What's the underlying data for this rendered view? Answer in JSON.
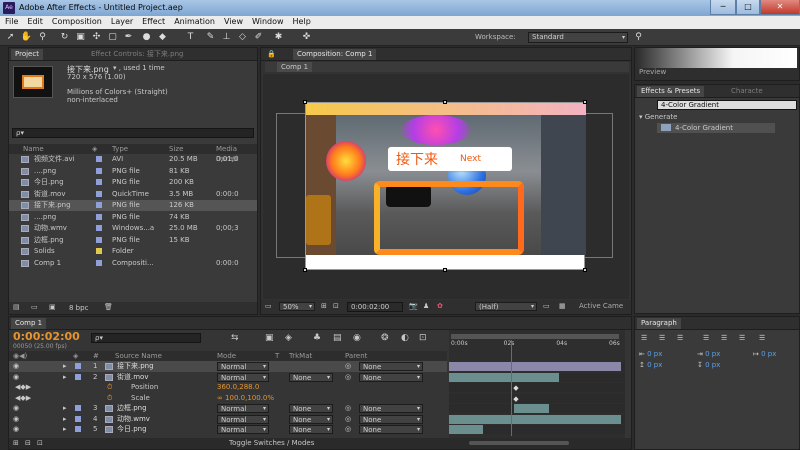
{
  "window": {
    "title": "Adobe After Effects - Untitled Project.aep",
    "app_badge": "Ae"
  },
  "menu": [
    "File",
    "Edit",
    "Composition",
    "Layer",
    "Effect",
    "Animation",
    "View",
    "Window",
    "Help"
  ],
  "toolbar": {
    "workspace_label": "Workspace:",
    "workspace_value": "Standard"
  },
  "project": {
    "tab_project": "Project",
    "tab_effect_controls": "Effect Controls: 接下来.png",
    "selected_name": "接下来.png",
    "selected_used": "▾ , used 1 time",
    "selected_dims": "720 x 576 (1.00)",
    "selected_colors": "Millions of Colors+ (Straight)",
    "selected_interlace": "non-interlaced",
    "search_placeholder": "ρ▾",
    "columns": [
      "Name",
      "Type",
      "Size",
      "Media Durati"
    ],
    "items": [
      {
        "name": "视频文件.avi",
        "type": "AVI",
        "size": "20.5 MB",
        "dur": "0;01;0",
        "color": "#8f9fd9"
      },
      {
        "name": "....png",
        "type": "PNG file",
        "size": "81 KB",
        "dur": "",
        "color": "#8f9fd9"
      },
      {
        "name": "今日.png",
        "type": "PNG file",
        "size": "200 KB",
        "dur": "",
        "color": "#8f9fd9"
      },
      {
        "name": "街道.mov",
        "type": "QuickTime",
        "size": "3.5 MB",
        "dur": "0:00:0",
        "color": "#8f9fd9"
      },
      {
        "name": "接下来.png",
        "type": "PNG file",
        "size": "126 KB",
        "dur": "",
        "color": "#8f9fd9"
      },
      {
        "name": "....png",
        "type": "PNG file",
        "size": "74 KB",
        "dur": "",
        "color": "#8f9fd9"
      },
      {
        "name": "动物.wmv",
        "type": "Windows...a",
        "size": "25.0 MB",
        "dur": "0;00;3",
        "color": "#8f9fd9"
      },
      {
        "name": "边框.png",
        "type": "PNG file",
        "size": "15 KB",
        "dur": "",
        "color": "#8f9fd9"
      },
      {
        "name": "Solids",
        "type": "Folder",
        "size": "",
        "dur": "",
        "color": "#e0c94a"
      },
      {
        "name": "Comp 1",
        "type": "Compositi...",
        "size": "",
        "dur": "0:00:0",
        "color": "#8f9fd9"
      }
    ],
    "bpc": "8 bpc"
  },
  "composition": {
    "tab": "Composition: Comp 1",
    "subtab": "Comp 1",
    "overlay_cn": "接下来",
    "overlay_en": "Next",
    "zoom": "50%",
    "time": "0:00:02:00",
    "resolution": "(Half)",
    "camera": "Active Came"
  },
  "preview": {
    "tab": "Preview"
  },
  "effects_presets": {
    "tab": "Effects & Presets",
    "tab2": "Characte",
    "search_value": "4-Color Gradient",
    "category": "Generate",
    "item": "4-Color Gradient"
  },
  "paragraph": {
    "tab": "Paragraph",
    "fields": [
      "0 px",
      "0 px",
      "0 px",
      "0 px",
      "0 px"
    ]
  },
  "timeline": {
    "tab": "Comp 1",
    "time": "0:00:02:00",
    "frames": "00050 (25.00 fps)",
    "search_placeholder": "ρ▾",
    "ruler": [
      "0:00s",
      "02s",
      "04s",
      "06s"
    ],
    "columns": [
      "Source Name",
      "Mode",
      "T",
      "TrkMat",
      "Parent"
    ],
    "layers": [
      {
        "num": "1",
        "name": "接下来.png",
        "mode": "Normal",
        "trkmat": "",
        "parent": "None",
        "color": "#8f9fd9",
        "bar_start": 0,
        "bar_end": 1
      },
      {
        "num": "2",
        "name": "街道.mov",
        "mode": "Normal",
        "trkmat": "None",
        "parent": "None",
        "color": "#8f9fd9",
        "bar_start": 0,
        "bar_end": 0.64
      },
      {
        "num": "3",
        "name": "边框.png",
        "mode": "Normal",
        "trkmat": "None",
        "parent": "None",
        "color": "#8f9fd9",
        "bar_start": 0.38,
        "bar_end": 0.58
      },
      {
        "num": "4",
        "name": "动物.wmv",
        "mode": "Normal",
        "trkmat": "None",
        "parent": "None",
        "color": "#8f9fd9",
        "bar_start": 0,
        "bar_end": 1
      },
      {
        "num": "5",
        "name": "今日.png",
        "mode": "Normal",
        "trkmat": "None",
        "parent": "None",
        "color": "#8f9fd9",
        "bar_start": 0,
        "bar_end": 0.2
      }
    ],
    "properties": [
      {
        "name": "Position",
        "value": "360.0,288.0"
      },
      {
        "name": "Scale",
        "value": "∞ 100.0,100.0%"
      }
    ],
    "bottom_cut": "Scale",
    "bottom_value": "∞ 100.0,100.0%",
    "footer": "Toggle Switches / Modes",
    "playhead_fraction": 0.35
  }
}
